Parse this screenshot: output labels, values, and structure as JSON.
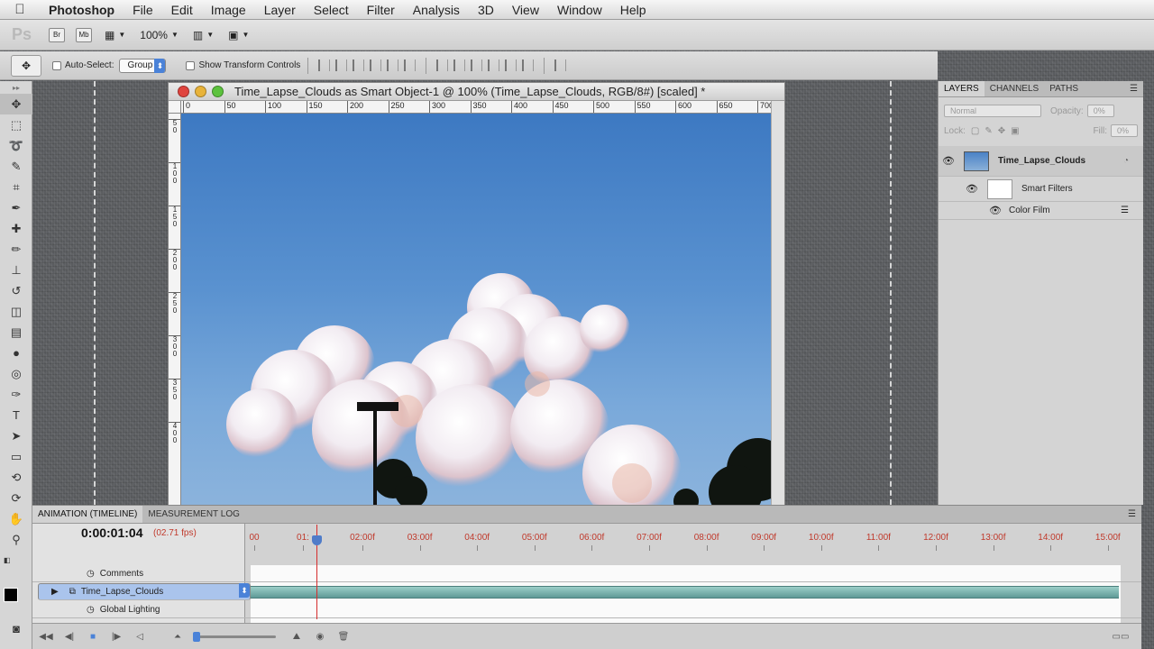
{
  "menubar": {
    "app_name": "Photoshop",
    "menus": [
      "File",
      "Edit",
      "Image",
      "Layer",
      "Select",
      "Filter",
      "Analysis",
      "3D",
      "View",
      "Window",
      "Help"
    ]
  },
  "appbar": {
    "logo": "Ps",
    "bridge": "Br",
    "minibridge": "Mb",
    "zoom": "100%"
  },
  "options": {
    "auto_select_label": "Auto-Select:",
    "auto_select_value": "Group",
    "transform_label": "Show Transform Controls"
  },
  "document": {
    "title": "Time_Lapse_Clouds as Smart Object-1 @ 100% (Time_Lapse_Clouds, RGB/8#) [scaled] *",
    "ruler_h": [
      "0",
      "50",
      "100",
      "150",
      "200",
      "250",
      "300",
      "350",
      "400",
      "450",
      "500",
      "550",
      "600",
      "650",
      "700"
    ],
    "ruler_v": [
      "5 0",
      "1 0 0",
      "1 5 0",
      "2 0 0",
      "2 5 0",
      "3 0 0",
      "3 5 0",
      "4 0 0"
    ]
  },
  "layers_panel": {
    "tabs": [
      "LAYERS",
      "CHANNELS",
      "PATHS"
    ],
    "blend_mode": "Normal",
    "opacity_label": "Opacity:",
    "opacity": "0%",
    "lock_label": "Lock:",
    "fill_label": "Fill:",
    "fill": "0%",
    "layers": [
      {
        "name": "Time_Lapse_Clouds"
      },
      {
        "name": "Smart Filters"
      },
      {
        "name": "Color Film"
      }
    ]
  },
  "timeline": {
    "tabs": [
      "ANIMATION (TIMELINE)",
      "MEASUREMENT LOG"
    ],
    "timecode": "0:00:01:04",
    "fps": "(02.71 fps)",
    "ticks": [
      "00",
      "01:",
      "02:00f",
      "03:00f",
      "04:00f",
      "05:00f",
      "06:00f",
      "07:00f",
      "08:00f",
      "09:00f",
      "10:00f",
      "11:00f",
      "12:00f",
      "13:00f",
      "14:00f",
      "15:00f"
    ],
    "rows": [
      {
        "label": "Comments"
      },
      {
        "label": "Time_Lapse_Clouds"
      },
      {
        "label": "Global Lighting"
      }
    ]
  },
  "colors": {
    "accent": "#4a82d8",
    "playhead": "#d62c2c",
    "layer_bar": "#7fb6b1"
  }
}
